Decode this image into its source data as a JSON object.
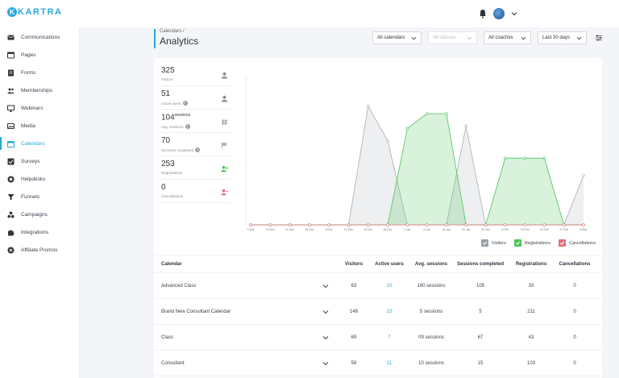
{
  "app": {
    "logo_letter": "K",
    "logo_text": "KARTRA"
  },
  "sidebar": {
    "items": [
      {
        "label": "Communications",
        "icon": "envelope-icon"
      },
      {
        "label": "Pages",
        "icon": "page-icon"
      },
      {
        "label": "Forms",
        "icon": "form-icon"
      },
      {
        "label": "Memberships",
        "icon": "members-icon"
      },
      {
        "label": "Webinars",
        "icon": "webinar-icon"
      },
      {
        "label": "Media",
        "icon": "media-icon"
      },
      {
        "label": "Calendars",
        "icon": "calendar-icon",
        "active": true
      },
      {
        "label": "Surveys",
        "icon": "survey-icon"
      },
      {
        "label": "Helpdesks",
        "icon": "helpdesk-icon"
      },
      {
        "label": "Funnels",
        "icon": "funnel-icon"
      },
      {
        "label": "Campaigns",
        "icon": "campaign-icon"
      },
      {
        "label": "Integrations",
        "icon": "puzzle-icon"
      },
      {
        "label": "Affiliate Promos",
        "icon": "affiliate-icon"
      }
    ]
  },
  "header": {
    "breadcrumb": "Calendars /",
    "title": "Analytics"
  },
  "filters": {
    "calendars": "All calendars",
    "classes": "All classes",
    "coaches": "All coaches",
    "range": "Last 30 days"
  },
  "stats": [
    {
      "value": "325",
      "label": "Visitors",
      "info": false
    },
    {
      "value": "51",
      "label": "Active users",
      "info": true
    },
    {
      "value": "104",
      "suffix": "sessions",
      "label": "Avg. sessions",
      "info": true
    },
    {
      "value": "70",
      "label": "Sessions completed",
      "info": true
    },
    {
      "value": "253",
      "label": "Registrations",
      "info": false
    },
    {
      "value": "0",
      "label": "Cancellations",
      "info": false
    }
  ],
  "colors": {
    "accent": "#2aa6df",
    "visitors": "#9aa0a8",
    "registrations": "#4cc35a",
    "cancellations": "#e0707a"
  },
  "chart_data": {
    "type": "area",
    "x": [
      "7 Nov",
      "14 Nov",
      "21 Nov",
      "28 Nov",
      "5 Dec",
      "12 Dec",
      "19 Dec",
      "26 Dec",
      "2 Jan",
      "9 Jan",
      "16 Jan",
      "23 Jan",
      "30 Jan",
      "6 Feb",
      "13 Feb",
      "20 Feb",
      "27 Feb",
      "6 Mar"
    ],
    "ylim": [
      0,
      3
    ],
    "yticks": [
      "0",
      "1",
      "2",
      "3"
    ],
    "series": [
      {
        "name": "Visitors",
        "values": [
          0,
          0,
          0,
          0,
          0,
          0,
          2.4,
          1.7,
          0,
          0,
          0,
          2.0,
          0,
          0,
          0,
          0,
          0,
          1.0
        ]
      },
      {
        "name": "Registrations",
        "values": [
          0,
          0,
          0,
          0,
          0,
          0,
          0,
          0,
          1.95,
          2.25,
          2.25,
          0,
          0,
          1.35,
          1.35,
          1.35,
          0,
          0
        ]
      },
      {
        "name": "Cancellations",
        "values": [
          0,
          0,
          0,
          0,
          0,
          0,
          0,
          0,
          0,
          0,
          0,
          0,
          0,
          0,
          0,
          0,
          0,
          0
        ]
      }
    ],
    "legend": "bottom-right"
  },
  "table": {
    "headers": [
      "Calendar",
      "Visitors",
      "Active users",
      "Avg. sessions",
      "Sessions completed",
      "Registrations",
      "Cancellations"
    ],
    "rows": [
      {
        "name": "Advanced Class",
        "visitors": "63",
        "active": "10",
        "avg": "160 sessions",
        "completed": "105",
        "registrations": "33",
        "cancellations": "0"
      },
      {
        "name": "Brand New Consultant Calendar",
        "visitors": "148",
        "active": "23",
        "avg": "5 sessions",
        "completed": "5",
        "registrations": "211",
        "cancellations": "0"
      },
      {
        "name": "Class",
        "visitors": "69",
        "active": "7",
        "avg": "09 sessions",
        "completed": "67",
        "registrations": "43",
        "cancellations": "0"
      },
      {
        "name": "Consultant",
        "visitors": "58",
        "active": "11",
        "avg": "10 sessions",
        "completed": "15",
        "registrations": "103",
        "cancellations": "0"
      }
    ]
  }
}
